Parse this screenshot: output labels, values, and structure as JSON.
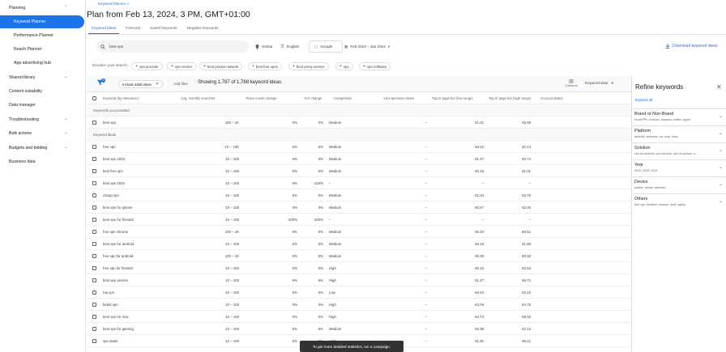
{
  "sidebar": {
    "items": [
      {
        "label": "Planning",
        "chev": "^",
        "top": 0
      },
      {
        "label": "Keyword Planner",
        "active": true
      },
      {
        "label": "Performance Planner"
      },
      {
        "label": "Reach Planner"
      },
      {
        "label": "App advertising hub"
      },
      {
        "label": "Shared library",
        "chev": "v"
      },
      {
        "label": "Content suitability"
      },
      {
        "label": "Data manager"
      },
      {
        "label": "Troubleshooting",
        "chev": "v"
      },
      {
        "label": "Bulk actions",
        "chev": "v"
      },
      {
        "label": "Budgets and bidding",
        "chev": "v"
      },
      {
        "label": "Business data"
      }
    ]
  },
  "header": {
    "breadcrumb": "Keyword Planner  >",
    "title": "Plan from Feb 13, 2024, 3 PM, GMT+01:00",
    "tabs": [
      "Keyword ideas",
      "Forecast",
      "Saved keywords",
      "Negative keywords"
    ]
  },
  "search": {
    "value": "best vpn",
    "location": "Serbia",
    "language": "English",
    "network": "Google",
    "dates": "Feb 2023 – Jan 2024",
    "download": "Download keyword ideas"
  },
  "broaden": {
    "label": "Broaden your search:",
    "chips": [
      "vpn provider",
      "vpn service",
      "best private network",
      "best free vpns",
      "best proxy service",
      "vpn",
      "vpn software"
    ]
  },
  "toolbar": {
    "filter_badge": "1",
    "exclude_chip": "Include adult ideas",
    "add_filter": "Add filter",
    "showing": "Showing 1,787 of 1,788 keyword ideas",
    "columns": "Columns",
    "keyword_view": "Keyword view"
  },
  "table": {
    "headers": [
      "Keyword (by relevance)",
      "Avg. monthly searches",
      "Three month change",
      "YoY change",
      "Competition",
      "Ad impression share",
      "Top of page bid (low range)",
      "Top of page bid (high range)",
      "Account status"
    ],
    "group_provided": "Keywords you provided",
    "group_ideas": "Keyword ideas",
    "provided": [
      [
        "best vpn",
        "100 – 1K",
        "0%",
        "0%",
        "Medium",
        "–",
        "€1.01",
        "€5.69",
        ""
      ]
    ],
    "ideas": [
      [
        "free vpn",
        "1K – 10K",
        "0%",
        "0%",
        "Medium",
        "–",
        "€0.22",
        "€1.14",
        ""
      ],
      [
        "best vpn 2023",
        "10 – 100",
        "0%",
        "0%",
        "Medium",
        "–",
        "€1.47",
        "€3.74",
        ""
      ],
      [
        "best free vpn",
        "10 – 100",
        "0%",
        "0%",
        "Medium",
        "–",
        "€0.15",
        "€1.01",
        ""
      ],
      [
        "best vpn 2022",
        "10 – 100",
        "0%",
        "-100%",
        "–",
        "–",
        "–",
        "–",
        ""
      ],
      [
        "cheap vpn",
        "10 – 100",
        "0%",
        "0%",
        "Medium",
        "–",
        "€1.04",
        "€3.75",
        ""
      ],
      [
        "best vpn for iphone",
        "10 – 100",
        "0%",
        "0%",
        "Medium",
        "–",
        "€0.57",
        "€2.05",
        ""
      ],
      [
        "best vpn for firestick",
        "10 – 100",
        "-100%",
        "-100%",
        "–",
        "–",
        "–",
        "–",
        ""
      ],
      [
        "free vpn chrome",
        "100 – 1K",
        "0%",
        "0%",
        "Medium",
        "–",
        "€0.20",
        "€0.61",
        ""
      ],
      [
        "best vpn for android",
        "10 – 100",
        "0%",
        "0%",
        "Medium",
        "–",
        "€0.18",
        "€1.89",
        ""
      ],
      [
        "free vpn for android",
        "100 – 1K",
        "0%",
        "0%",
        "Medium",
        "–",
        "€0.09",
        "€0.93",
        ""
      ],
      [
        "free vpn for firestick",
        "10 – 100",
        "0%",
        "0%",
        "High",
        "–",
        "€0.42",
        "€3.63",
        ""
      ],
      [
        "best vpn service",
        "10 – 100",
        "0%",
        "0%",
        "High",
        "–",
        "€1.47",
        "€5.71",
        ""
      ],
      [
        "top vpn",
        "10 – 100",
        "0%",
        "0%",
        "Low",
        "–",
        "€0.63",
        "€3.10",
        ""
      ],
      [
        "bedst vpn",
        "10 – 100",
        "0%",
        "0%",
        "High",
        "–",
        "€2.09",
        "€4.76",
        ""
      ],
      [
        "best vpn for mac",
        "10 – 100",
        "0%",
        "0%",
        "High",
        "–",
        "€2.73",
        "€8.55",
        ""
      ],
      [
        "best vpn for gaming",
        "10 – 100",
        "0%",
        "0%",
        "Medium",
        "–",
        "€0.35",
        "€2.13",
        ""
      ],
      [
        "vpn deals",
        "10 – 100",
        "0%",
        "0%",
        "High",
        "–",
        "€1.91",
        "€6.41",
        ""
      ]
    ]
  },
  "refine": {
    "title": "Refine keywords",
    "expand_all": "Expand all",
    "sections": [
      {
        "h": "Brand or Non-Brand",
        "s": "NordVPN, nordvpn, amazon, netflix, apple"
      },
      {
        "h": "Platform",
        "s": "android, windows, ios, mac, linux"
      },
      {
        "h": "Solution",
        "s": "vpn for android, vpn servers, vpn for iphone, v..."
      },
      {
        "h": "Year",
        "s": "2023, 2022, 2021"
      },
      {
        "h": "Device",
        "s": "mobile, phone, address"
      },
      {
        "h": "Others",
        "s": "free vpn, firestick, chrome, deal, laptop"
      }
    ]
  },
  "snackbar": "To get more detailed statistics, run a campaign."
}
